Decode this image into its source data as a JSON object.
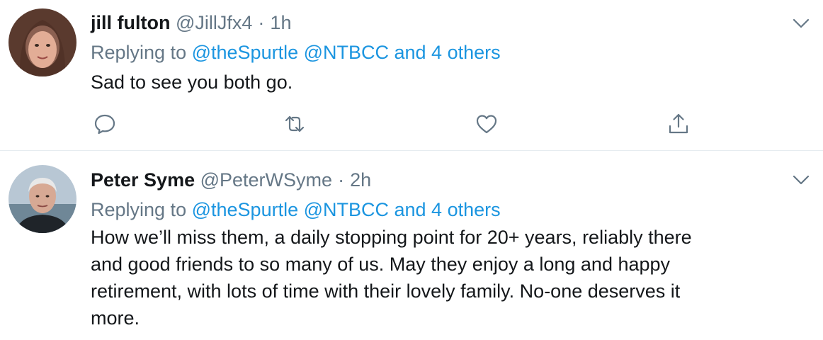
{
  "tweets": [
    {
      "display_name": "jill fulton",
      "handle": "@JillJfx4",
      "separator": "·",
      "time": "1h",
      "replying_prefix": "Replying to",
      "mentions": "@theSpurtle @NTBCC and 4 others",
      "text": "Sad to see you both go."
    },
    {
      "display_name": "Peter Syme",
      "handle": "@PeterWSyme",
      "separator": "·",
      "time": "2h",
      "replying_prefix": "Replying to",
      "mentions": "@theSpurtle @NTBCC and 4 others",
      "text_lines": [
        "How we’ll miss them, a daily stopping point for 20+ years, reliably there",
        "and good friends to so many of us. May they enjoy a long and happy",
        "retirement, with lots of time with their lovely family. No-one deserves it",
        "more."
      ]
    }
  ],
  "icons": {
    "reply": "reply-icon",
    "retweet": "retweet-icon",
    "like": "heart-icon",
    "share": "share-icon",
    "menu": "chevron-down-icon"
  },
  "colors": {
    "text": "#14171a",
    "muted": "#657786",
    "link": "#1b95e0",
    "divider": "#e6ecf0"
  }
}
